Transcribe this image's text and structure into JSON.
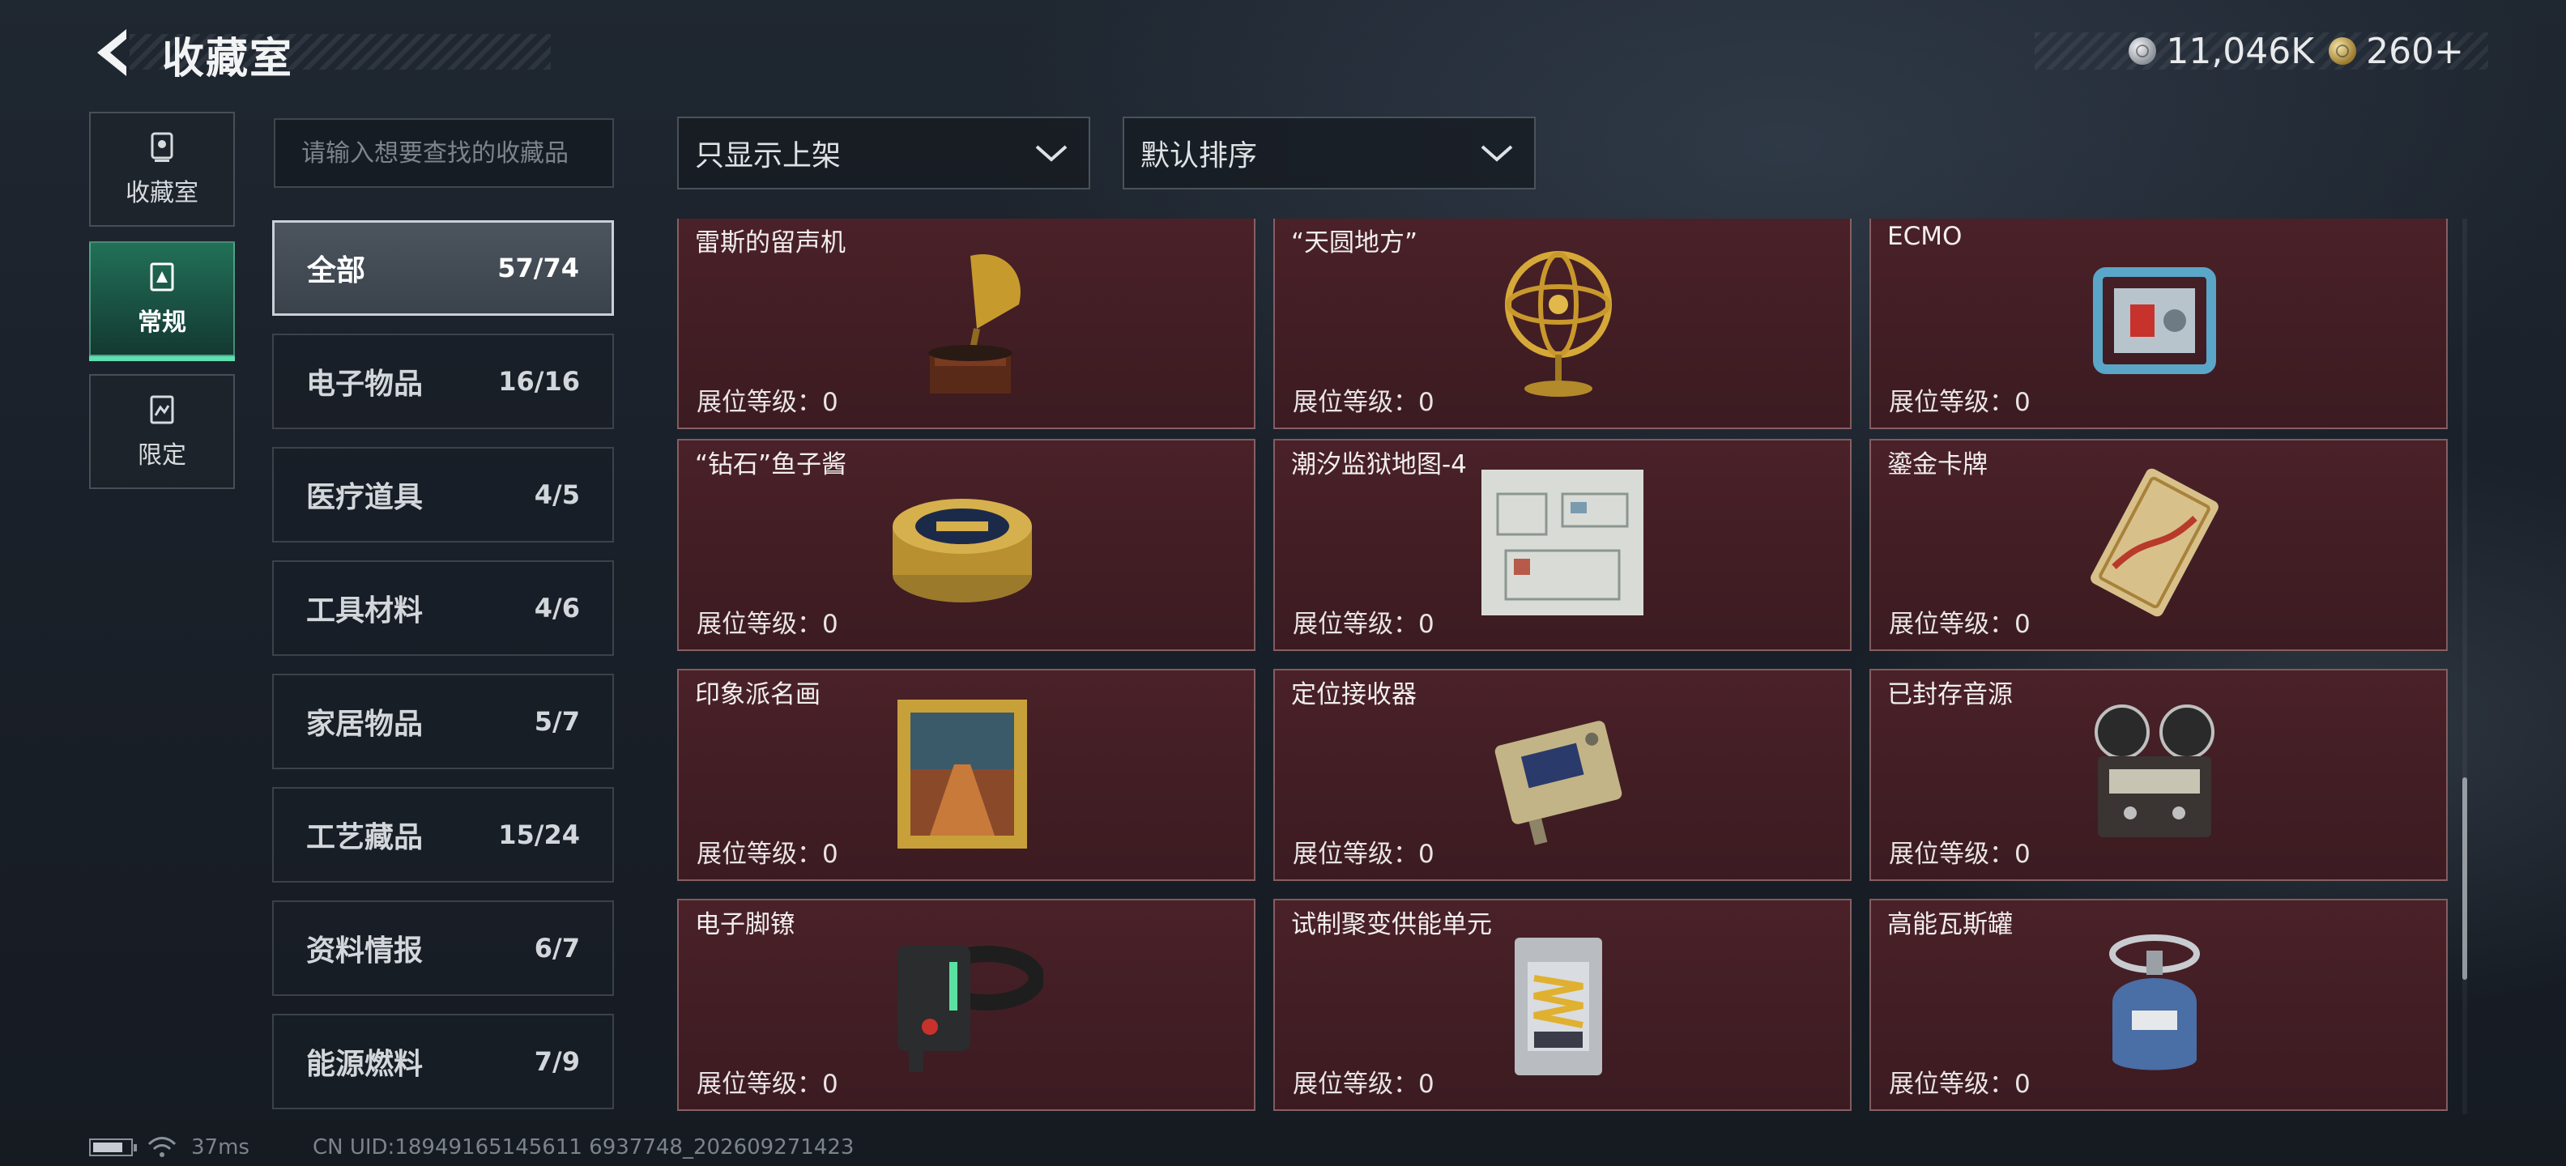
{
  "header": {
    "title": "收藏室"
  },
  "currency": [
    {
      "icon": "silver-coin-icon",
      "value": "11,046K"
    },
    {
      "icon": "gold-coin-icon",
      "value": "260+"
    }
  ],
  "nav": [
    {
      "label": "收藏室",
      "icon": "trophy-icon",
      "active": false
    },
    {
      "label": "常规",
      "icon": "card-icon",
      "active": true
    },
    {
      "label": "限定",
      "icon": "limited-card-icon",
      "active": false
    }
  ],
  "search": {
    "placeholder": "请输入想要查找的收藏品",
    "value": ""
  },
  "filters": {
    "display": "只显示上架",
    "sort": "默认排序"
  },
  "categories": [
    {
      "name": "全部",
      "count": "57/74",
      "active": true
    },
    {
      "name": "电子物品",
      "count": "16/16"
    },
    {
      "name": "医疗道具",
      "count": "4/5"
    },
    {
      "name": "工具材料",
      "count": "4/6"
    },
    {
      "name": "家居物品",
      "count": "5/7"
    },
    {
      "name": "工艺藏品",
      "count": "15/24"
    },
    {
      "name": "资料情报",
      "count": "6/7"
    },
    {
      "name": "能源燃料",
      "count": "7/9"
    }
  ],
  "items": [
    {
      "name": "雷斯的留声机",
      "level": "展位等级：0",
      "icon": "gramophone-icon"
    },
    {
      "name": "“天圆地方”",
      "level": "展位等级：0",
      "icon": "armillary-sphere-icon"
    },
    {
      "name": "ECMO",
      "level": "展位等级：0",
      "icon": "ecmo-machine-icon"
    },
    {
      "name": "“钻石”鱼子酱",
      "level": "展位等级：0",
      "icon": "caviar-tin-icon"
    },
    {
      "name": "潮汐监狱地图-4",
      "level": "展位等级：0",
      "icon": "prison-map-icon"
    },
    {
      "name": "鎏金卡牌",
      "level": "展位等级：0",
      "icon": "gilded-card-icon"
    },
    {
      "name": "印象派名画",
      "level": "展位等级：0",
      "icon": "framed-painting-icon"
    },
    {
      "name": "定位接收器",
      "level": "展位等级：0",
      "icon": "locator-receiver-icon"
    },
    {
      "name": "已封存音源",
      "level": "展位等级：0",
      "icon": "reel-recorder-icon"
    },
    {
      "name": "电子脚镣",
      "level": "展位等级：0",
      "icon": "electronic-shackle-icon"
    },
    {
      "name": "试制聚变供能单元",
      "level": "展位等级：0",
      "icon": "fusion-cell-icon"
    },
    {
      "name": "高能瓦斯罐",
      "level": "展位等级：0",
      "icon": "gas-canister-icon"
    }
  ],
  "footer": {
    "ping": "37ms",
    "uid": "CN UID:18949165145611 6937748_202609271423"
  }
}
